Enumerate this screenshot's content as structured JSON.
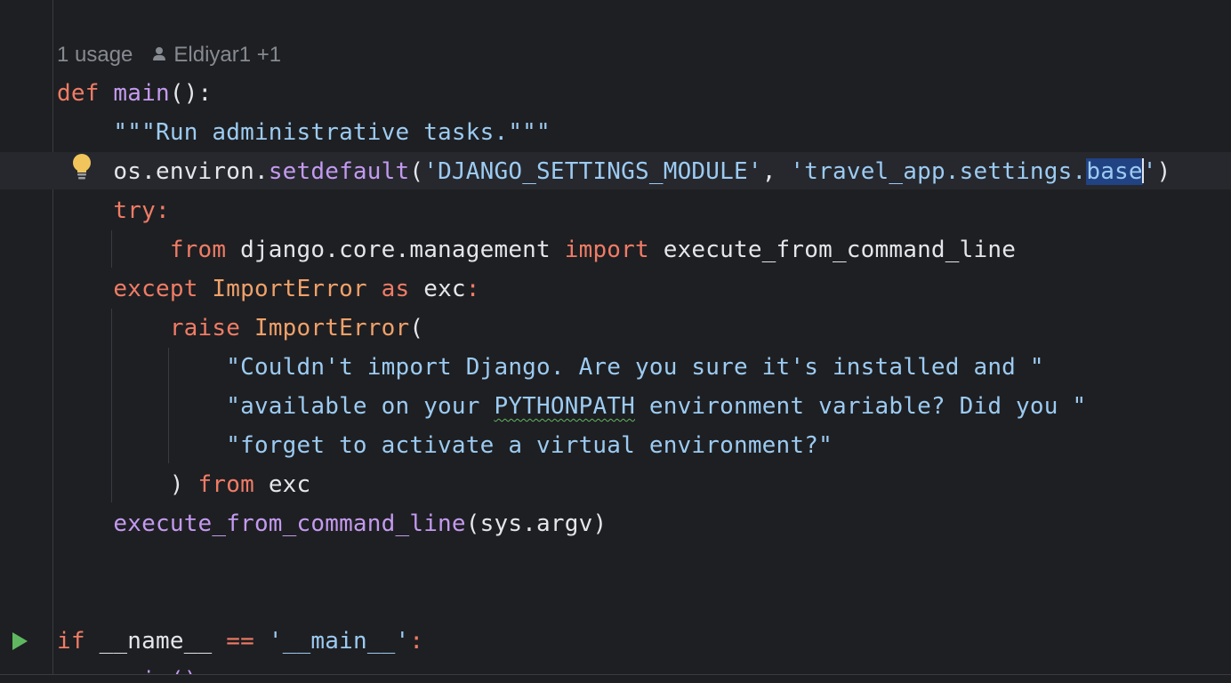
{
  "inlay_hint": {
    "usages": "1 usage",
    "author": "Eldiyar1 +1"
  },
  "code": {
    "l1": {
      "kw": "def",
      "name": "main",
      "rest": "():"
    },
    "l2": {
      "docstring": "\"\"\"Run administrative tasks.\"\"\""
    },
    "l3": {
      "obj": "os.environ.",
      "method": "setdefault",
      "paren_open": "(",
      "arg1": "'DJANGO_SETTINGS_MODULE'",
      "comma": ", ",
      "arg2_a": "'travel_app.settings.",
      "arg2_sel": "base",
      "arg2_b": "'",
      "paren_close": ")"
    },
    "l4": {
      "kw": "try",
      "colon": ":"
    },
    "l5": {
      "kw_from": "from",
      "module": " django.core.management ",
      "kw_import": "import",
      "name": " execute_from_command_line"
    },
    "l6": {
      "kw_except": "except",
      "cls": "ImportError",
      "kw_as": "as",
      "var": " exc",
      "colon": ":"
    },
    "l7": {
      "kw_raise": "raise",
      "cls": "ImportError",
      "paren": "("
    },
    "l8": {
      "str": "\"Couldn't import Django. Are you sure it's installed and \""
    },
    "l9": {
      "str_a": "\"available on your ",
      "str_typo": "PYTHONPATH",
      "str_b": " environment variable? Did you \""
    },
    "l10": {
      "str": "\"forget to activate a virtual environment?\""
    },
    "l11": {
      "paren": ")",
      "kw_from": "from",
      "var": " exc"
    },
    "l12": {
      "call": "execute_from_command_line",
      "args": "(sys.argv)"
    },
    "l13": {
      "kw_if": "if",
      "name": " __name__ ",
      "op": "==",
      "str": "'__main__'",
      "colon": ":"
    },
    "l14": {
      "partial": "main()"
    }
  },
  "colors": {
    "background": "#1e1f22",
    "current_line": "#26282e",
    "keyword": "#f07c66",
    "function": "#c49af0",
    "string": "#9ccbf2",
    "class": "#f0a16a",
    "selection": "#214283",
    "run_icon": "#5fb860",
    "bulb": "#f2c55c"
  },
  "icons": {
    "bulb": "lightbulb-icon",
    "run": "run-play-icon",
    "person": "person-icon"
  }
}
